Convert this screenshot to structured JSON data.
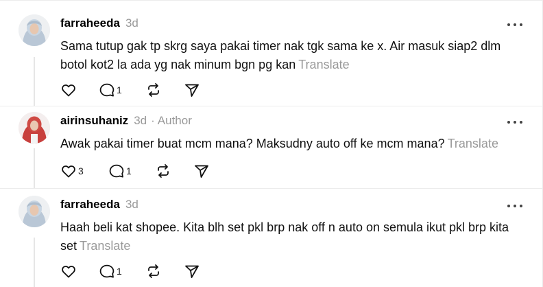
{
  "posts": [
    {
      "username": "farraheeda",
      "time": "3d",
      "author_tag": "",
      "text": "Sama tutup gak tp skrg saya pakai timer nak tgk sama ke x. Air masuk siap2 dlm botol kot2 la ada yg nak minum bgn pg kan",
      "translate": "Translate",
      "likes": "",
      "replies": "1"
    },
    {
      "username": "airinsuhaniz",
      "time": "3d",
      "author_tag": "Author",
      "text": "Awak pakai timer buat mcm mana? Maksudny auto off ke mcm mana?",
      "translate": "Translate",
      "likes": "3",
      "replies": "1"
    },
    {
      "username": "farraheeda",
      "time": "3d",
      "author_tag": "",
      "text": "Haah beli kat shopee. Kita blh set pkl brp nak off n auto on semula ikut pkl brp kita set",
      "translate": "Translate",
      "likes": "",
      "replies": "1"
    }
  ],
  "icons": {
    "like": "heart-icon",
    "reply": "comment-icon",
    "repost": "repost-icon",
    "share": "send-icon",
    "more": "more-icon"
  },
  "colors": {
    "muted": "#999999",
    "divider": "#ececec",
    "thread_line": "#e6e6e6"
  }
}
